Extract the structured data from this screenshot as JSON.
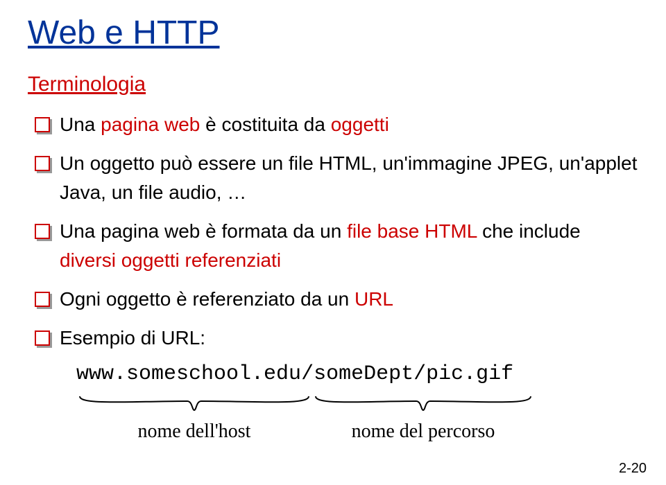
{
  "title": "Web e HTTP",
  "subtitle": "Terminologia",
  "bullets": [
    {
      "pre": "Una ",
      "em1": "pagina web",
      "mid1": " è costituita da ",
      "em2": "oggetti",
      "post": ""
    },
    {
      "pre": "Un oggetto può essere un file HTML, un'immagine JPEG, un'applet Java, un file audio, …",
      "em1": "",
      "mid1": "",
      "em2": "",
      "post": ""
    },
    {
      "pre": "Una pagina web è formata da un ",
      "em1": "file base HTML",
      "mid1": " che include ",
      "em2": "diversi oggetti referenziati",
      "post": ""
    },
    {
      "pre": "Ogni oggetto è referenziato da un ",
      "em1": "URL",
      "mid1": "",
      "em2": "",
      "post": ""
    },
    {
      "pre": "Esempio di URL:",
      "em1": "",
      "mid1": "",
      "em2": "",
      "post": ""
    }
  ],
  "url": {
    "host": "www.someschool.edu",
    "path": "/someDept/pic.gif"
  },
  "labels": {
    "host": "nome dell'host",
    "path": "nome del percorso"
  },
  "slide_number": "2-20"
}
